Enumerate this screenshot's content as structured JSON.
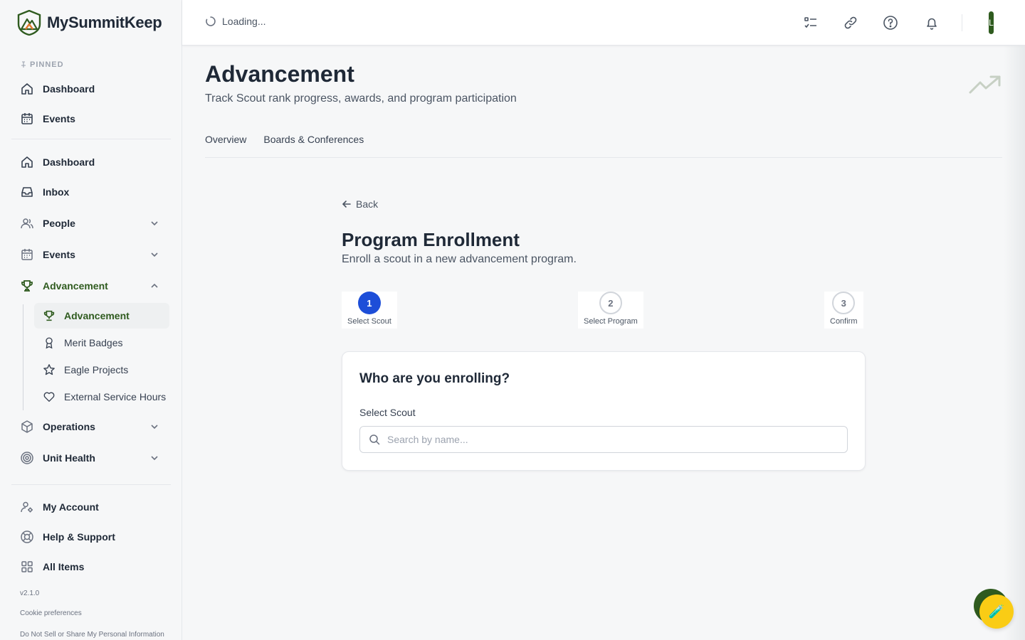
{
  "brand": {
    "name": "MySummitKeep"
  },
  "sidebar": {
    "pinned_label": "PINNED",
    "pinned": [
      {
        "label": "Dashboard",
        "icon": "home-icon"
      },
      {
        "label": "Events",
        "icon": "calendar-icon"
      }
    ],
    "main": [
      {
        "label": "Dashboard",
        "icon": "home-icon"
      },
      {
        "label": "Inbox",
        "icon": "inbox-icon"
      },
      {
        "label": "People",
        "icon": "users-icon",
        "expandable": true
      },
      {
        "label": "Events",
        "icon": "calendar-icon",
        "expandable": true
      },
      {
        "label": "Advancement",
        "icon": "trophy-icon",
        "expanded": true,
        "active": true
      },
      {
        "label": "Operations",
        "icon": "box-icon",
        "expandable": true
      },
      {
        "label": "Unit Health",
        "icon": "target-icon",
        "expandable": true
      }
    ],
    "advancement_sub": [
      {
        "label": "Advancement",
        "icon": "trophy-icon",
        "active": true
      },
      {
        "label": "Merit Badges",
        "icon": "ribbon-icon"
      },
      {
        "label": "Eagle Projects",
        "icon": "star-icon"
      },
      {
        "label": "External Service Hours",
        "icon": "heart-icon"
      }
    ],
    "bottom": [
      {
        "label": "My Account",
        "icon": "user-settings-icon"
      },
      {
        "label": "Help & Support",
        "icon": "lifebuoy-icon"
      },
      {
        "label": "All Items",
        "icon": "grid-icon"
      }
    ],
    "version": "v2.1.0",
    "cookie_link": "Cookie preferences",
    "privacy_link": "Do Not Sell or Share My Personal Information"
  },
  "topbar": {
    "loading_text": "Loading...",
    "icons": [
      "checklist-icon",
      "link-icon",
      "help-icon",
      "bell-icon"
    ],
    "avatar_initial": "L"
  },
  "page": {
    "title": "Advancement",
    "subtitle": "Track Scout rank progress, awards, and program participation",
    "tabs": [
      "Overview",
      "Boards & Conferences"
    ]
  },
  "enrollment": {
    "back_label": "Back",
    "title": "Program Enrollment",
    "subtitle": "Enroll a scout in a new advancement program.",
    "steps": [
      {
        "number": "1",
        "label": "Select Scout",
        "state": "current"
      },
      {
        "number": "2",
        "label": "Select Program",
        "state": "pending"
      },
      {
        "number": "3",
        "label": "Confirm",
        "state": "pending"
      }
    ],
    "card_title": "Who are you enrolling?",
    "field_label": "Select Scout",
    "search_placeholder": "Search by name..."
  },
  "colors": {
    "brand_green": "#2f5b1f",
    "step_active": "#1d4ed8",
    "fab_yellow": "#facc15"
  }
}
